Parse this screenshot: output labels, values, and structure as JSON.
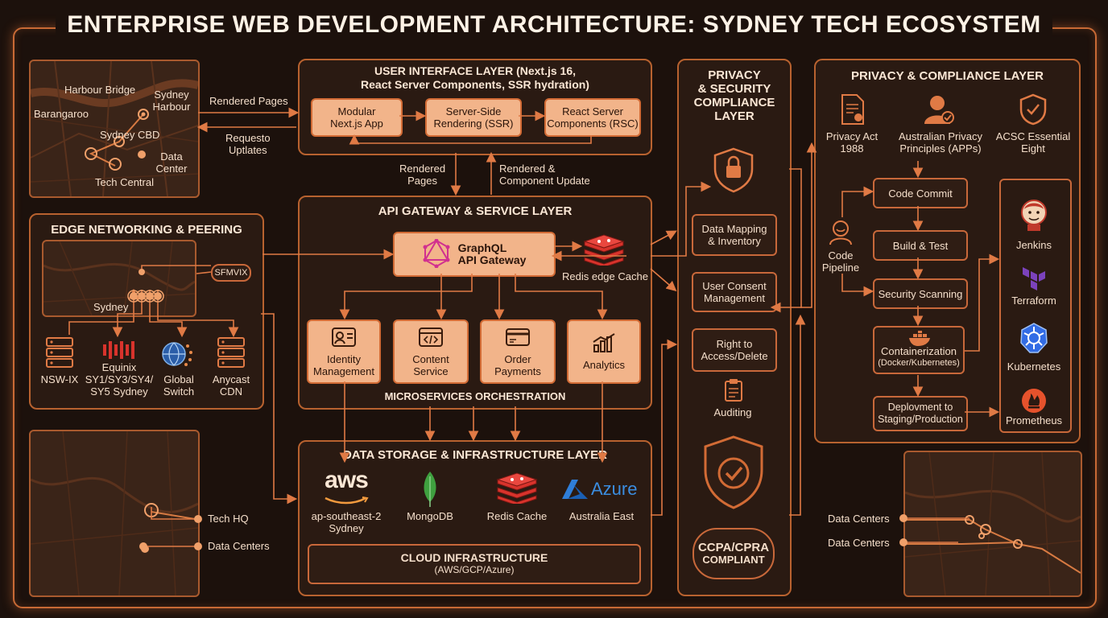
{
  "title": "ENTERPRISE WEB DEVELOPMENT ARCHITECTURE: SYDNEY TECH ECOSYSTEM",
  "colors": {
    "accent": "#c86a35",
    "panel": "#2a1a12",
    "box_fill": "#f2b48a"
  },
  "sydney_map": {
    "labels": [
      "Harbour Bridge",
      "Sydney Harbour",
      "Barangaroo",
      "Sydney CBD",
      "Data Center",
      "Tech Central"
    ]
  },
  "ui_flow": {
    "rendered_pages": "Rendered Pages",
    "request_updates_1": "Requesto",
    "request_updates_2": "Uptlates"
  },
  "ui_layer": {
    "title_1": "USER INTERFACE LAYER (Next.js 16,",
    "title_2": "React Server Components, SSR hydration)",
    "boxes": [
      {
        "l1": "Modular",
        "l2": "Next.js App"
      },
      {
        "l1": "Server-Side",
        "l2": "Rendering (SSR)"
      },
      {
        "l1": "React Server",
        "l2": "Components (RSC)"
      }
    ]
  },
  "mid_flow": {
    "left_1": "Rendered",
    "left_2": "Pages",
    "right_1": "Rendered &",
    "right_2": "Component Update"
  },
  "edge": {
    "title": "EDGE NETWORKING & PEERING",
    "ix_label": "SFMVIX",
    "map_label": "Sydney",
    "items": [
      {
        "l1": "NSW-IX",
        "l2": "",
        "l3": ""
      },
      {
        "l1": "Equinix",
        "l2": "SY1/SY3/SY4/",
        "l3": "SY5 Sydney"
      },
      {
        "l1": "Global",
        "l2": "Switch",
        "l3": ""
      },
      {
        "l1": "Anycast",
        "l2": "CDN",
        "l3": ""
      }
    ]
  },
  "api": {
    "title": "API GATEWAY & SERVICE LAYER",
    "gateway_1": "GraphQL",
    "gateway_2": "API Gateway",
    "redis": "Redis edge Cache",
    "services": [
      {
        "l1": "Identity",
        "l2": "Management",
        "icon": "id-card-icon"
      },
      {
        "l1": "Content",
        "l2": "Service",
        "icon": "code-window-icon"
      },
      {
        "l1": "Order",
        "l2": "Payments",
        "icon": "payment-card-icon"
      },
      {
        "l1": "Analytics",
        "l2": "",
        "icon": "bar-chart-icon"
      }
    ],
    "orchestration": "MICROSERVICES ORCHESTRATION"
  },
  "bottom_map": {
    "tech_hq": "Tech HQ",
    "data_centers": "Data Centers"
  },
  "data_layer": {
    "title": "DATA STORAGE & INFRASTRUCTURE LAYER",
    "providers": [
      {
        "logo": "aws",
        "l1": "ap-southeast-2",
        "l2": "Sydney"
      },
      {
        "logo": "",
        "l1": "MongoDB",
        "l2": ""
      },
      {
        "logo": "",
        "l1": "Redis Cache",
        "l2": ""
      },
      {
        "logo": "Azure",
        "l1": "Australia East",
        "l2": ""
      }
    ],
    "cloud_1": "CLOUD INFRASTRUCTURE",
    "cloud_2": "(AWS/GCP/Azure)"
  },
  "privacy_col": {
    "title_1": "PRIVACY",
    "title_2": "& SECURITY",
    "title_3": "COMPLIANCE",
    "title_4": "LAYER",
    "items": [
      {
        "l1": "Data Mapping",
        "l2": "& Inventory"
      },
      {
        "l1": "User Consent",
        "l2": "Management"
      },
      {
        "l1": "Right to",
        "l2": "Access/Delete"
      },
      {
        "l1": "Auditing",
        "l2": ""
      }
    ],
    "badge_1": "CCPA/CPRA",
    "badge_2": "COMPLIANT"
  },
  "compliance": {
    "title": "PRIVACY & COMPLIANCE LAYER",
    "items": [
      {
        "l1": "Privacy Act",
        "l2": "1988"
      },
      {
        "l1": "Australian Privacy",
        "l2": "Principles (APPs)"
      },
      {
        "l1": "ACSC Essential",
        "l2": "Eight"
      }
    ],
    "pipeline_1": "Code",
    "pipeline_2": "Pipeline",
    "steps": [
      {
        "l1": "Code Commit",
        "l2": ""
      },
      {
        "l1": "Build & Test",
        "l2": ""
      },
      {
        "l1": "Security Scanning",
        "l2": ""
      },
      {
        "l1": "Containerization",
        "l2": "(Docker/Kubernetes)"
      },
      {
        "l1": "Deplovment to",
        "l2": "Staging/Production"
      }
    ],
    "tools": [
      "Jenkins",
      "Terraform",
      "Kubernetes",
      "Prometheus"
    ]
  },
  "right_map": {
    "dc_1": "Data Centers",
    "dc_2": "Data Centers"
  }
}
